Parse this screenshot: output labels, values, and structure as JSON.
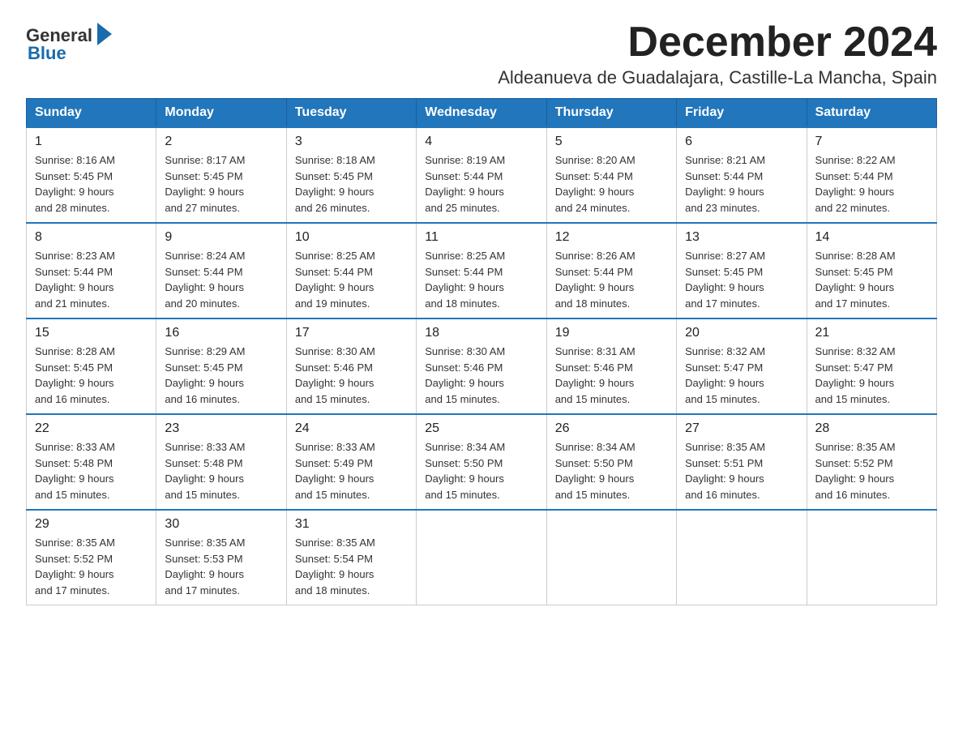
{
  "logo": {
    "text_general": "General",
    "text_blue": "Blue"
  },
  "title": "December 2024",
  "subtitle": "Aldeanueva de Guadalajara, Castille-La Mancha, Spain",
  "weekdays": [
    "Sunday",
    "Monday",
    "Tuesday",
    "Wednesday",
    "Thursday",
    "Friday",
    "Saturday"
  ],
  "weeks": [
    [
      {
        "day": "1",
        "sunrise": "8:16 AM",
        "sunset": "5:45 PM",
        "daylight": "9 hours and 28 minutes."
      },
      {
        "day": "2",
        "sunrise": "8:17 AM",
        "sunset": "5:45 PM",
        "daylight": "9 hours and 27 minutes."
      },
      {
        "day": "3",
        "sunrise": "8:18 AM",
        "sunset": "5:45 PM",
        "daylight": "9 hours and 26 minutes."
      },
      {
        "day": "4",
        "sunrise": "8:19 AM",
        "sunset": "5:44 PM",
        "daylight": "9 hours and 25 minutes."
      },
      {
        "day": "5",
        "sunrise": "8:20 AM",
        "sunset": "5:44 PM",
        "daylight": "9 hours and 24 minutes."
      },
      {
        "day": "6",
        "sunrise": "8:21 AM",
        "sunset": "5:44 PM",
        "daylight": "9 hours and 23 minutes."
      },
      {
        "day": "7",
        "sunrise": "8:22 AM",
        "sunset": "5:44 PM",
        "daylight": "9 hours and 22 minutes."
      }
    ],
    [
      {
        "day": "8",
        "sunrise": "8:23 AM",
        "sunset": "5:44 PM",
        "daylight": "9 hours and 21 minutes."
      },
      {
        "day": "9",
        "sunrise": "8:24 AM",
        "sunset": "5:44 PM",
        "daylight": "9 hours and 20 minutes."
      },
      {
        "day": "10",
        "sunrise": "8:25 AM",
        "sunset": "5:44 PM",
        "daylight": "9 hours and 19 minutes."
      },
      {
        "day": "11",
        "sunrise": "8:25 AM",
        "sunset": "5:44 PM",
        "daylight": "9 hours and 18 minutes."
      },
      {
        "day": "12",
        "sunrise": "8:26 AM",
        "sunset": "5:44 PM",
        "daylight": "9 hours and 18 minutes."
      },
      {
        "day": "13",
        "sunrise": "8:27 AM",
        "sunset": "5:45 PM",
        "daylight": "9 hours and 17 minutes."
      },
      {
        "day": "14",
        "sunrise": "8:28 AM",
        "sunset": "5:45 PM",
        "daylight": "9 hours and 17 minutes."
      }
    ],
    [
      {
        "day": "15",
        "sunrise": "8:28 AM",
        "sunset": "5:45 PM",
        "daylight": "9 hours and 16 minutes."
      },
      {
        "day": "16",
        "sunrise": "8:29 AM",
        "sunset": "5:45 PM",
        "daylight": "9 hours and 16 minutes."
      },
      {
        "day": "17",
        "sunrise": "8:30 AM",
        "sunset": "5:46 PM",
        "daylight": "9 hours and 15 minutes."
      },
      {
        "day": "18",
        "sunrise": "8:30 AM",
        "sunset": "5:46 PM",
        "daylight": "9 hours and 15 minutes."
      },
      {
        "day": "19",
        "sunrise": "8:31 AM",
        "sunset": "5:46 PM",
        "daylight": "9 hours and 15 minutes."
      },
      {
        "day": "20",
        "sunrise": "8:32 AM",
        "sunset": "5:47 PM",
        "daylight": "9 hours and 15 minutes."
      },
      {
        "day": "21",
        "sunrise": "8:32 AM",
        "sunset": "5:47 PM",
        "daylight": "9 hours and 15 minutes."
      }
    ],
    [
      {
        "day": "22",
        "sunrise": "8:33 AM",
        "sunset": "5:48 PM",
        "daylight": "9 hours and 15 minutes."
      },
      {
        "day": "23",
        "sunrise": "8:33 AM",
        "sunset": "5:48 PM",
        "daylight": "9 hours and 15 minutes."
      },
      {
        "day": "24",
        "sunrise": "8:33 AM",
        "sunset": "5:49 PM",
        "daylight": "9 hours and 15 minutes."
      },
      {
        "day": "25",
        "sunrise": "8:34 AM",
        "sunset": "5:50 PM",
        "daylight": "9 hours and 15 minutes."
      },
      {
        "day": "26",
        "sunrise": "8:34 AM",
        "sunset": "5:50 PM",
        "daylight": "9 hours and 15 minutes."
      },
      {
        "day": "27",
        "sunrise": "8:35 AM",
        "sunset": "5:51 PM",
        "daylight": "9 hours and 16 minutes."
      },
      {
        "day": "28",
        "sunrise": "8:35 AM",
        "sunset": "5:52 PM",
        "daylight": "9 hours and 16 minutes."
      }
    ],
    [
      {
        "day": "29",
        "sunrise": "8:35 AM",
        "sunset": "5:52 PM",
        "daylight": "9 hours and 17 minutes."
      },
      {
        "day": "30",
        "sunrise": "8:35 AM",
        "sunset": "5:53 PM",
        "daylight": "9 hours and 17 minutes."
      },
      {
        "day": "31",
        "sunrise": "8:35 AM",
        "sunset": "5:54 PM",
        "daylight": "9 hours and 18 minutes."
      },
      null,
      null,
      null,
      null
    ]
  ],
  "labels": {
    "sunrise": "Sunrise:",
    "sunset": "Sunset:",
    "daylight": "Daylight:"
  }
}
